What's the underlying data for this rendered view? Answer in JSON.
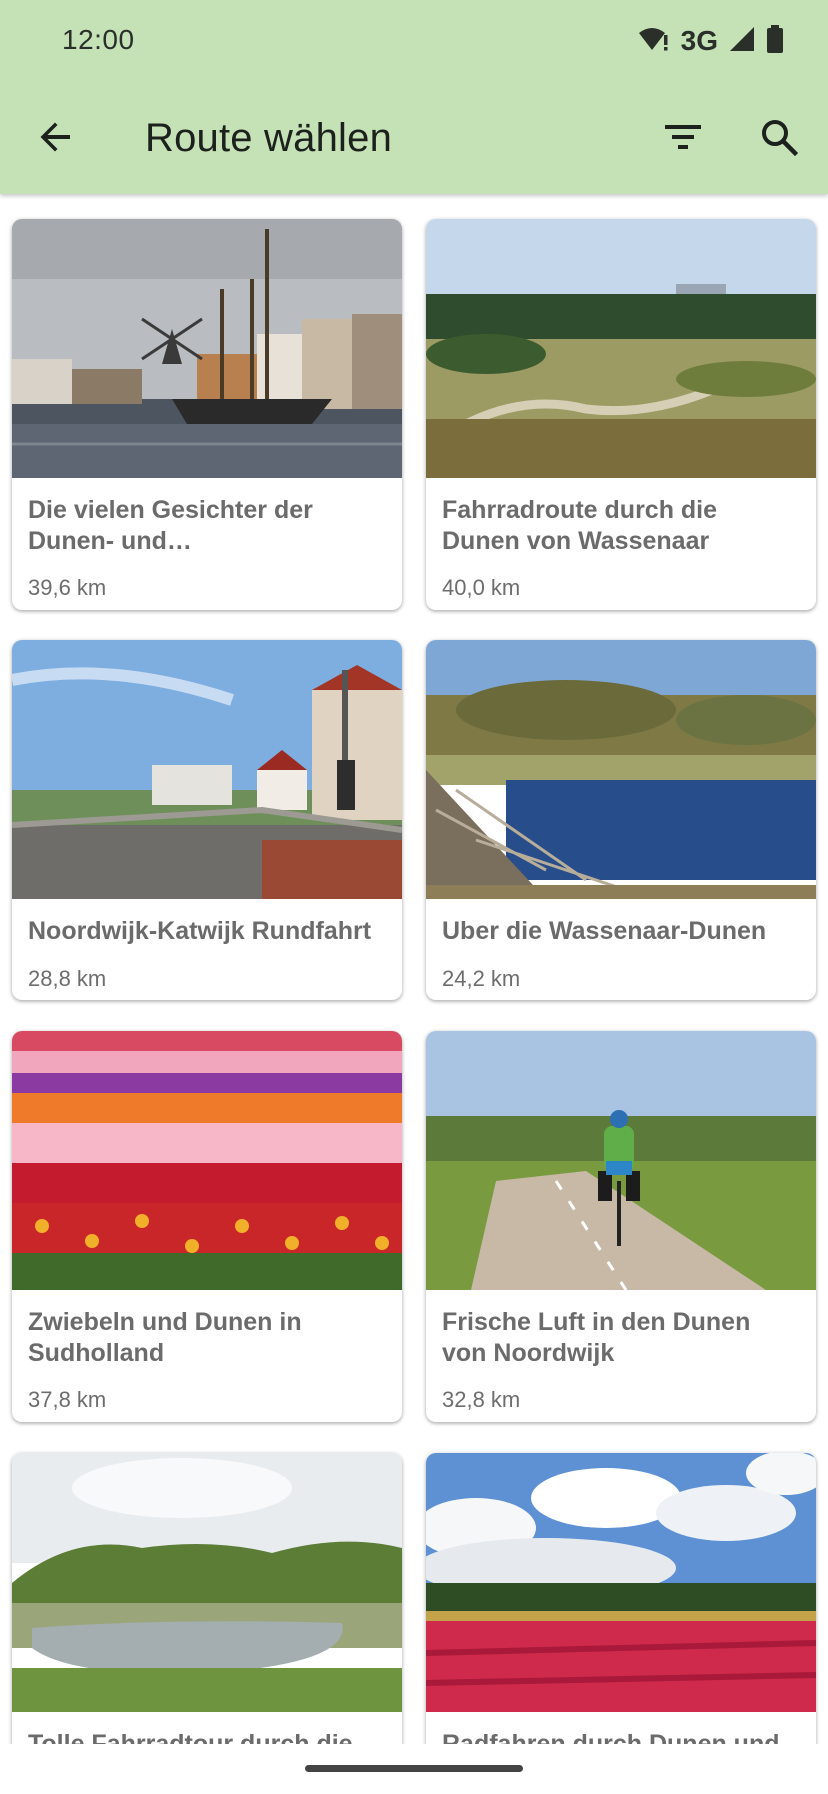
{
  "status_bar": {
    "time": "12:00",
    "network": "3G",
    "icons": [
      "wifi-alert-icon",
      "signal-icon",
      "battery-icon"
    ]
  },
  "toolbar": {
    "title": "Route wählen",
    "back_icon": "arrow-back-icon",
    "filter_icon": "filter-icon",
    "search_icon": "search-icon"
  },
  "colors": {
    "header_bg": "#c5e2b7",
    "title_text": "#6b6b6b"
  },
  "routes": [
    {
      "title": "Die vielen Gesichter der Dunen- und Blumenzwiebelregion",
      "distance": "39,6 km",
      "image": "harbor-windmill-photo"
    },
    {
      "title": "Fahrradroute durch die Dunen von Wassenaar",
      "distance": "40,0 km",
      "image": "dunes-cyclists-photo"
    },
    {
      "title": "Noordwijk-Katwijk Rundfahrt",
      "distance": "28,8 km",
      "image": "seaside-promenade-photo"
    },
    {
      "title": "Uber die Wassenaar-Dunen",
      "distance": "24,2 km",
      "image": "dune-lake-photo"
    },
    {
      "title": "Zwiebeln und Dunen in Sudholland",
      "distance": "37,8 km",
      "image": "tulip-field-photo"
    },
    {
      "title": "Frische Luft in den Dunen von Noordwijk",
      "distance": "32,8 km",
      "image": "cyclist-path-photo"
    },
    {
      "title": "Tolle Fahrradtour durch die Dunen",
      "distance": "",
      "image": "dune-pond-photo"
    },
    {
      "title": "Radfahren durch Dunen und Blumenfelder",
      "distance": "",
      "image": "flower-field-clouds-photo"
    }
  ]
}
